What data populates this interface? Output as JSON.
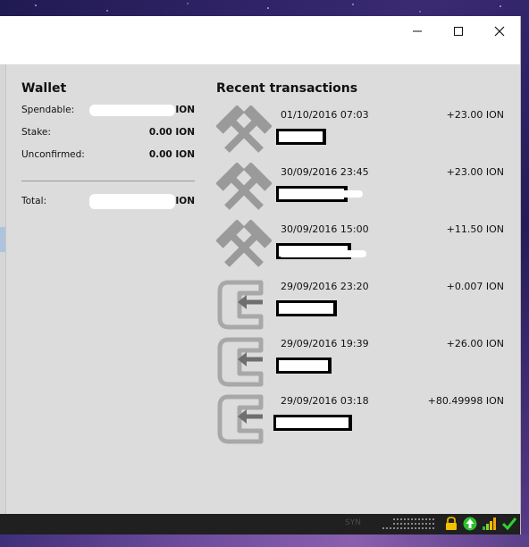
{
  "window": {
    "controls": [
      "minimize",
      "maximize",
      "close"
    ]
  },
  "wallet": {
    "title": "Wallet",
    "spendable_label": "Spendable:",
    "spendable_unit": "ION",
    "stake_label": "Stake:",
    "stake_value": "0.00 ION",
    "unconfirmed_label": "Unconfirmed:",
    "unconfirmed_value": "0.00 ION",
    "total_label": "Total:",
    "total_unit": "ION"
  },
  "transactions": {
    "title": "Recent transactions",
    "items": [
      {
        "icon": "mining-icon",
        "date": "01/10/2016 07:03",
        "amount": "+23.00 ION"
      },
      {
        "icon": "mining-icon",
        "date": "30/09/2016 23:45",
        "amount": "+23.00 ION"
      },
      {
        "icon": "mining-icon",
        "date": "30/09/2016 15:00",
        "amount": "+11.50 ION"
      },
      {
        "icon": "receive-icon",
        "date": "29/09/2016 23:20",
        "amount": "+0.007 ION"
      },
      {
        "icon": "receive-icon",
        "date": "29/09/2016 19:39",
        "amount": "+26.00 ION"
      },
      {
        "icon": "receive-icon",
        "date": "29/09/2016 03:18",
        "amount": "+80.49998 ION"
      }
    ]
  },
  "statusbar": {
    "network_label": "SYN",
    "icons": [
      "activity-icon",
      "lock-icon",
      "staking-icon",
      "signal-icon",
      "synced-check-icon"
    ]
  }
}
